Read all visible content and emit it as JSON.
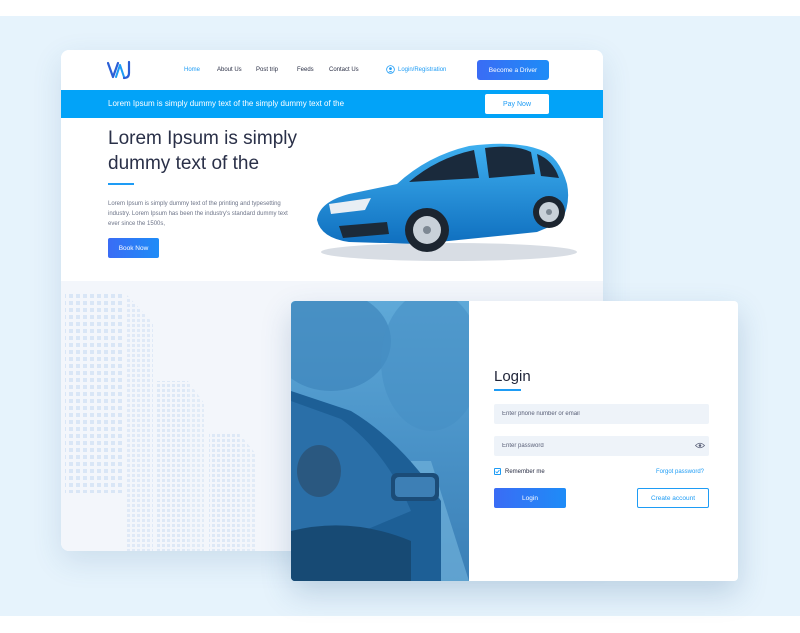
{
  "site": {
    "logo_text": "VAJ",
    "nav": {
      "items": [
        {
          "label": "Home",
          "active": true
        },
        {
          "label": "About Us",
          "active": false
        },
        {
          "label": "Post trip",
          "active": false
        },
        {
          "label": "Feeds",
          "active": false
        },
        {
          "label": "Contact Us",
          "active": false
        }
      ],
      "login_label": "Login/Registration",
      "driver_button": "Become a Driver"
    },
    "banner": {
      "text": "Lorem Ipsum is simply dummy text of the simply dummy text of the",
      "button": "Pay Now"
    },
    "hero": {
      "title": "Lorem Ipsum is simply dummy text of the",
      "description": "Lorem Ipsum is simply dummy text of the printing and typesetting industry. Lorem Ipsum has been the industry's standard dummy text ever since the 1500s,",
      "button": "Book Now"
    }
  },
  "login": {
    "title": "Login",
    "phone_placeholder": "Enter phone number or email",
    "password_placeholder": "Enter password",
    "remember_label": "Remember me",
    "remember_checked": true,
    "forgot_label": "Forgot password?",
    "login_button": "Login",
    "create_button": "Create account"
  },
  "colors": {
    "accent": "#1e9cf5",
    "banner": "#02a3f8",
    "background": "#e6f3fc",
    "car": "#1b86d6"
  },
  "icons": [
    "logo",
    "user-circle-icon",
    "eye-icon",
    "check-icon"
  ]
}
